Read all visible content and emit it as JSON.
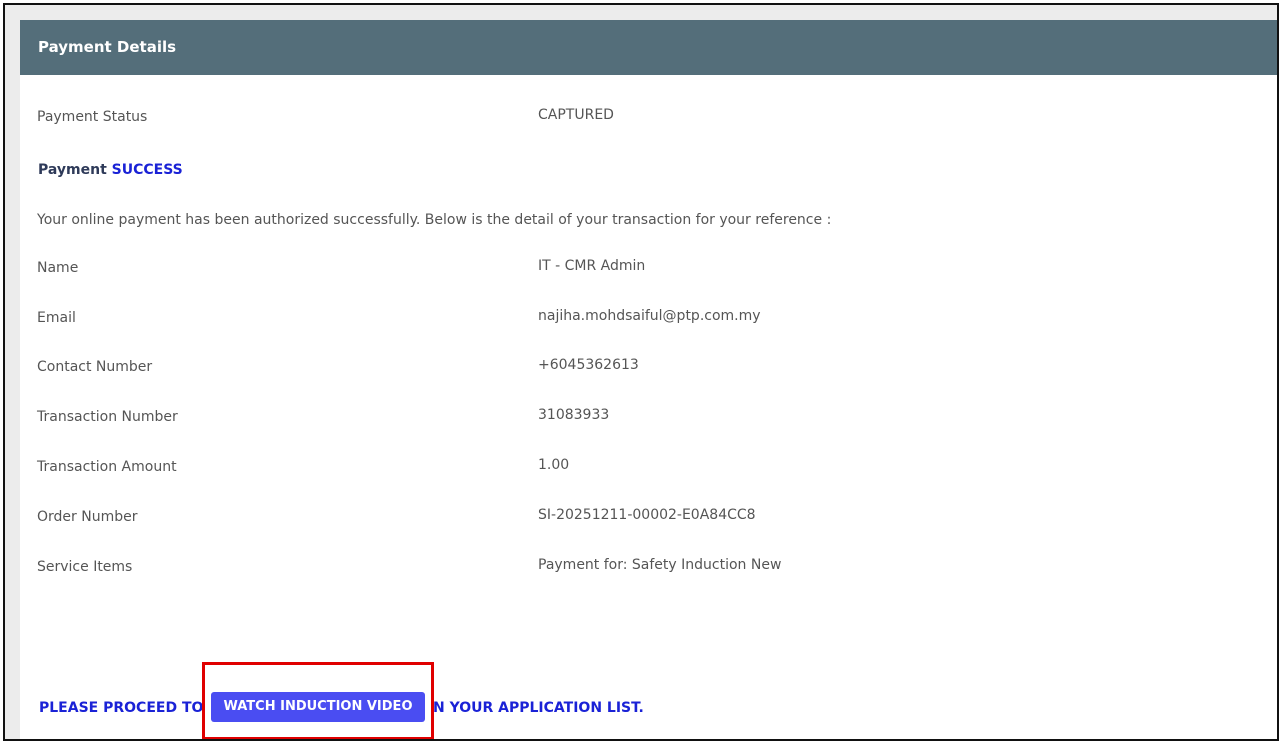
{
  "header": {
    "title": "Payment Details"
  },
  "status": {
    "label": "Payment Status",
    "value": "CAPTURED"
  },
  "success": {
    "prefix": "Payment",
    "word": "SUCCESS"
  },
  "message": "Your online payment has been authorized successfully. Below is the detail of your transaction for your reference :",
  "details": [
    {
      "label": "Name",
      "value": "IT - CMR Admin"
    },
    {
      "label": "Email",
      "value": "najiha.mohdsaiful@ptp.com.my"
    },
    {
      "label": "Contact Number",
      "value": "+6045362613"
    },
    {
      "label": "Transaction Number",
      "value": "31083933"
    },
    {
      "label": "Transaction Amount",
      "value": "1.00"
    },
    {
      "label": "Order Number",
      "value": "SI-20251211-00002-E0A84CC8"
    },
    {
      "label": "Service Items",
      "value": "Payment for: Safety Induction New"
    }
  ],
  "proceed": {
    "before": "PLEASE PROCEED TO",
    "button_label": "WATCH INDUCTION VIDEO",
    "after": "N YOUR APPLICATION LIST."
  },
  "colors": {
    "header_bg": "#546e7a",
    "accent_blue": "#1a22d6",
    "button_bg": "#4a4df2",
    "highlight_red": "#e00000"
  }
}
